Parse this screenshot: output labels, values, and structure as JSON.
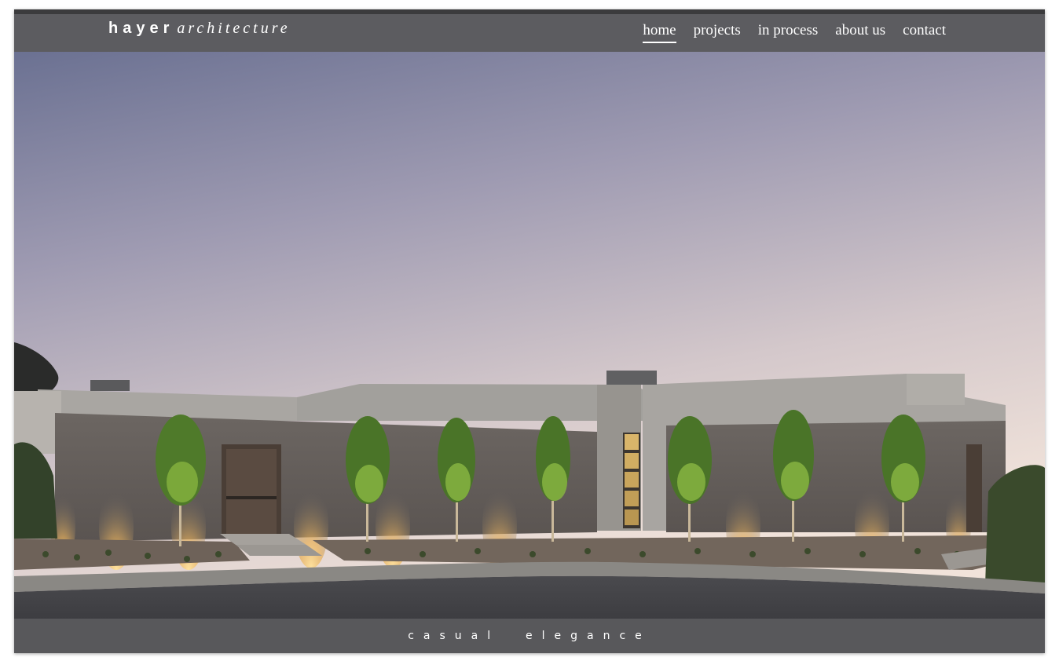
{
  "brand": {
    "name_bold": "hayer",
    "name_italic": "architecture"
  },
  "nav": [
    {
      "label": "home",
      "active": true
    },
    {
      "label": "projects",
      "active": false
    },
    {
      "label": "in process",
      "active": false
    },
    {
      "label": "about us",
      "active": false
    },
    {
      "label": "contact",
      "active": false
    }
  ],
  "tagline": "casual  elegance",
  "colors": {
    "bar": "#5c5c60",
    "text": "#ffffff",
    "sky_top": "#6f7593",
    "sky_bottom": "#e9dcd6",
    "wall": "#6e6763",
    "light": "#ffd98a",
    "tree": "#5f8a32"
  }
}
